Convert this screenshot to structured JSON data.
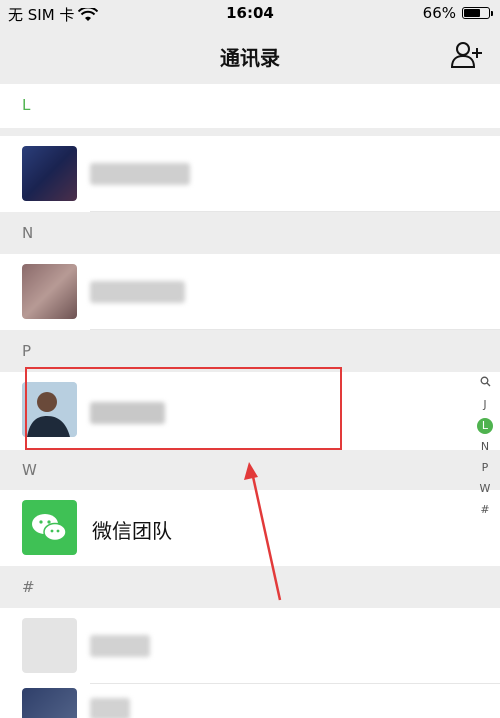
{
  "status_bar": {
    "carrier": "无 SIM 卡",
    "time": "16:04",
    "battery": "66%",
    "battery_level": 0.66
  },
  "header": {
    "title": "通讯录"
  },
  "sections": [
    {
      "letter": "L"
    },
    {
      "letter": "N"
    },
    {
      "letter": "P"
    },
    {
      "letter": "W"
    },
    {
      "letter": "#"
    }
  ],
  "contacts": {
    "wechat_team": "微信团队"
  },
  "index_bar": [
    "J",
    "L",
    "N",
    "P",
    "W",
    "#"
  ],
  "colors": {
    "accent": "#4fb34f",
    "highlight": "#e23a3a",
    "wechat_green": "#3fc155"
  }
}
